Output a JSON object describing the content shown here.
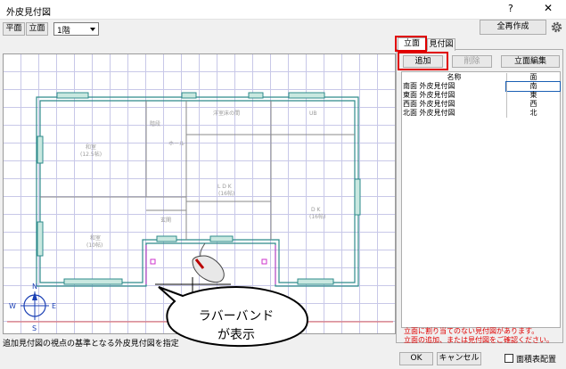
{
  "window": {
    "title": "外皮見付図",
    "help": "?",
    "close": "✕"
  },
  "toolbar": {
    "plan_label": "平面",
    "elevation_label": "立面",
    "floor_value": "1階",
    "regenerate_label": "全再作成",
    "settings_icon": "gear-icon"
  },
  "tabs": [
    {
      "label": "立面",
      "active": true
    },
    {
      "label": "見付図",
      "active": false
    }
  ],
  "panel_buttons": {
    "add": "追加",
    "delete": "削除",
    "edit": "立面編集"
  },
  "list": {
    "headers": {
      "name": "名称",
      "face": "面"
    },
    "rows": [
      {
        "name": "南面 外皮見付図",
        "face": "南",
        "selected": true
      },
      {
        "name": "東面 外皮見付図",
        "face": "東",
        "selected": false
      },
      {
        "name": "西面 外皮見付図",
        "face": "西",
        "selected": false
      },
      {
        "name": "北面 外皮見付図",
        "face": "北",
        "selected": false
      }
    ]
  },
  "notice": {
    "line1": "立面に割り当てのない見付図があります。",
    "line2": "立面の追加、または見付図をご確認ください。"
  },
  "plan_labels": {
    "room1": "階段",
    "room2": "洋室床の間",
    "room3": "UB",
    "room4": "和室",
    "room4_sub": "(12.5帖)",
    "room5": "ホール",
    "room6": "L D K",
    "room6_sub": "(16帖)",
    "room7": "D K",
    "room7_sub": "(16帖)",
    "room8": "玄関",
    "room9": "和室",
    "room9_sub": "(10帖)"
  },
  "compass": {
    "n": "N",
    "s": "S",
    "e": "E",
    "w": "W"
  },
  "callout": {
    "line1": "ラバーバンド",
    "line2": "が表示"
  },
  "status_text": "追加見付図の視点の基準となる外皮見付図を指定",
  "footer": {
    "ok": "OK",
    "cancel": "キャンセル",
    "checkbox_label": "面積表配置",
    "checkbox_checked": false
  },
  "colors": {
    "highlight": "#e00000",
    "wall": "#2e8b8b",
    "magenta": "#cc33cc",
    "grid": "#c8c8e8"
  }
}
